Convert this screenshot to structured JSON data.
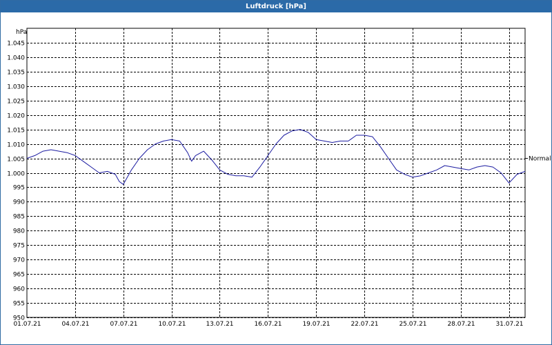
{
  "window": {
    "title": "Luftdruck [hPa]"
  },
  "colors": {
    "title_bar": "#2b6aa8",
    "line": "#1a1aa0",
    "grid": "#000000"
  },
  "chart_data": {
    "type": "line",
    "title": "Luftdruck [hPa]",
    "ylabel": "hPa",
    "xlabel": "",
    "ylim": [
      950,
      1050
    ],
    "yticks": [
      950,
      955,
      960,
      965,
      970,
      975,
      980,
      985,
      990,
      995,
      1000,
      1005,
      1010,
      1015,
      1020,
      1025,
      1030,
      1035,
      1040,
      1045
    ],
    "ytick_labels": [
      "950",
      "955",
      "960",
      "965",
      "970",
      "975",
      "980",
      "985",
      "990",
      "995",
      "1.000",
      "1.005",
      "1.010",
      "1.015",
      "1.020",
      "1.025",
      "1.030",
      "1.035",
      "1.040",
      "1.045"
    ],
    "xlim": [
      "2021-07-01",
      "2021-08-01"
    ],
    "xticks": [
      "2021-07-01",
      "2021-07-04",
      "2021-07-07",
      "2021-07-10",
      "2021-07-13",
      "2021-07-16",
      "2021-07-19",
      "2021-07-22",
      "2021-07-25",
      "2021-07-28",
      "2021-07-31"
    ],
    "xtick_labels": [
      "01.07.21",
      "04.07.21",
      "07.07.21",
      "10.07.21",
      "13.07.21",
      "16.07.21",
      "19.07.21",
      "22.07.21",
      "25.07.21",
      "28.07.21",
      "31.07.21"
    ],
    "grid": true,
    "reference_line": {
      "label": "Normal",
      "value": 1005
    },
    "series": [
      {
        "x": [
          "2021-07-01 00:00",
          "2021-07-01 12:00",
          "2021-07-02 00:00",
          "2021-07-02 12:00",
          "2021-07-03 00:00",
          "2021-07-03 12:00",
          "2021-07-04 00:00",
          "2021-07-04 12:00",
          "2021-07-05 00:00",
          "2021-07-05 12:00",
          "2021-07-06 00:00",
          "2021-07-06 12:00",
          "2021-07-06 18:00",
          "2021-07-07 00:00",
          "2021-07-07 12:00",
          "2021-07-08 00:00",
          "2021-07-08 12:00",
          "2021-07-09 00:00",
          "2021-07-09 12:00",
          "2021-07-10 00:00",
          "2021-07-10 12:00",
          "2021-07-11 00:00",
          "2021-07-11 06:00",
          "2021-07-11 12:00",
          "2021-07-12 00:00",
          "2021-07-12 12:00",
          "2021-07-13 00:00",
          "2021-07-13 12:00",
          "2021-07-14 00:00",
          "2021-07-14 12:00",
          "2021-07-15 00:00",
          "2021-07-15 12:00",
          "2021-07-16 00:00",
          "2021-07-16 12:00",
          "2021-07-17 00:00",
          "2021-07-17 12:00",
          "2021-07-18 00:00",
          "2021-07-18 12:00",
          "2021-07-19 00:00",
          "2021-07-19 12:00",
          "2021-07-20 00:00",
          "2021-07-20 12:00",
          "2021-07-21 00:00",
          "2021-07-21 12:00",
          "2021-07-22 00:00",
          "2021-07-22 12:00",
          "2021-07-23 00:00",
          "2021-07-23 12:00",
          "2021-07-24 00:00",
          "2021-07-24 12:00",
          "2021-07-25 00:00",
          "2021-07-25 12:00",
          "2021-07-26 00:00",
          "2021-07-26 12:00",
          "2021-07-27 00:00",
          "2021-07-27 12:00",
          "2021-07-28 00:00",
          "2021-07-28 12:00",
          "2021-07-29 00:00",
          "2021-07-29 12:00",
          "2021-07-30 00:00",
          "2021-07-30 12:00",
          "2021-07-31 00:00",
          "2021-07-31 12:00",
          "2021-08-01 00:00"
        ],
        "values": [
          1005,
          1006,
          1007.5,
          1008,
          1007.5,
          1007,
          1006,
          1004,
          1002,
          1000,
          1000.5,
          999.5,
          997,
          996,
          1001,
          1005,
          1008,
          1010,
          1011,
          1011.5,
          1011,
          1007,
          1004,
          1006,
          1007.5,
          1004.5,
          1001,
          999.5,
          999,
          999,
          998.5,
          1002,
          1006,
          1010,
          1013,
          1014.5,
          1015,
          1014,
          1011.5,
          1011,
          1010.5,
          1011,
          1011,
          1013,
          1013,
          1012.5,
          1009,
          1005,
          1001,
          999.5,
          998.5,
          999,
          1000,
          1001,
          1002.5,
          1002,
          1001.5,
          1001,
          1002,
          1002.5,
          1002,
          1000,
          996.5,
          999.5,
          1000.5
        ]
      }
    ]
  }
}
